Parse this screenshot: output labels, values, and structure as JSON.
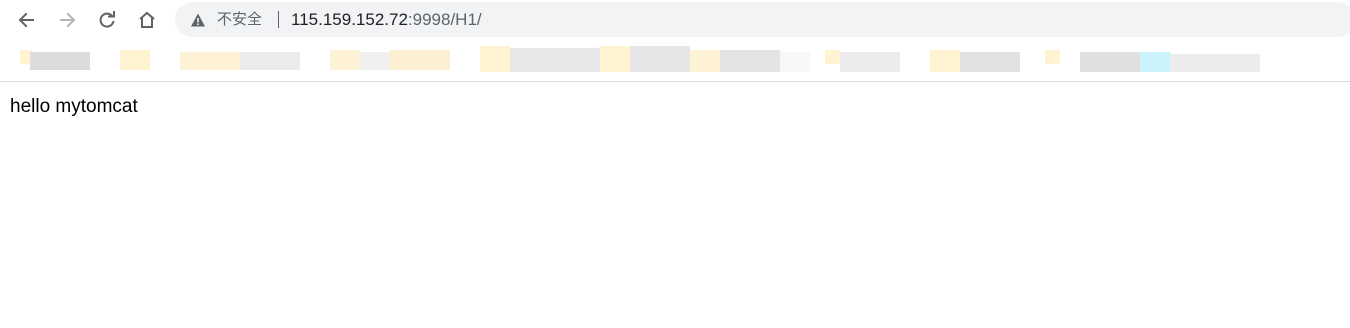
{
  "browser": {
    "nav": {
      "back_icon": "arrow-left-icon",
      "forward_icon": "arrow-right-icon",
      "reload_icon": "reload-icon",
      "home_icon": "home-icon"
    },
    "address_bar": {
      "security_icon": "warning-triangle-icon",
      "security_label": "不安全",
      "url_host": "115.159.152.72",
      "url_rest": ":9998/H1/"
    },
    "bookmarks_bar": {
      "note": "",
      "colors": {
        "folder": "#fff3d1",
        "gray": "#e3e3e3",
        "light": "#f4f4f4",
        "cyan": "#cbf3fb"
      }
    }
  },
  "page": {
    "body_text": "hello mytomcat"
  },
  "colors": {
    "omnibox_bg": "#f1f3f4",
    "icon": "#5f6368",
    "text": "#202124"
  }
}
